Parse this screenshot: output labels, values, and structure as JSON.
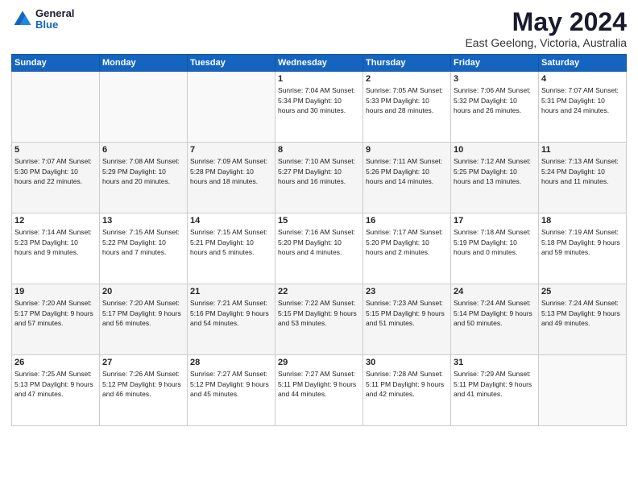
{
  "header": {
    "logo_general": "General",
    "logo_blue": "Blue",
    "month": "May 2024",
    "location": "East Geelong, Victoria, Australia"
  },
  "weekdays": [
    "Sunday",
    "Monday",
    "Tuesday",
    "Wednesday",
    "Thursday",
    "Friday",
    "Saturday"
  ],
  "weeks": [
    [
      {
        "day": "",
        "text": ""
      },
      {
        "day": "",
        "text": ""
      },
      {
        "day": "",
        "text": ""
      },
      {
        "day": "1",
        "text": "Sunrise: 7:04 AM\nSunset: 5:34 PM\nDaylight: 10 hours\nand 30 minutes."
      },
      {
        "day": "2",
        "text": "Sunrise: 7:05 AM\nSunset: 5:33 PM\nDaylight: 10 hours\nand 28 minutes."
      },
      {
        "day": "3",
        "text": "Sunrise: 7:06 AM\nSunset: 5:32 PM\nDaylight: 10 hours\nand 26 minutes."
      },
      {
        "day": "4",
        "text": "Sunrise: 7:07 AM\nSunset: 5:31 PM\nDaylight: 10 hours\nand 24 minutes."
      }
    ],
    [
      {
        "day": "5",
        "text": "Sunrise: 7:07 AM\nSunset: 5:30 PM\nDaylight: 10 hours\nand 22 minutes."
      },
      {
        "day": "6",
        "text": "Sunrise: 7:08 AM\nSunset: 5:29 PM\nDaylight: 10 hours\nand 20 minutes."
      },
      {
        "day": "7",
        "text": "Sunrise: 7:09 AM\nSunset: 5:28 PM\nDaylight: 10 hours\nand 18 minutes."
      },
      {
        "day": "8",
        "text": "Sunrise: 7:10 AM\nSunset: 5:27 PM\nDaylight: 10 hours\nand 16 minutes."
      },
      {
        "day": "9",
        "text": "Sunrise: 7:11 AM\nSunset: 5:26 PM\nDaylight: 10 hours\nand 14 minutes."
      },
      {
        "day": "10",
        "text": "Sunrise: 7:12 AM\nSunset: 5:25 PM\nDaylight: 10 hours\nand 13 minutes."
      },
      {
        "day": "11",
        "text": "Sunrise: 7:13 AM\nSunset: 5:24 PM\nDaylight: 10 hours\nand 11 minutes."
      }
    ],
    [
      {
        "day": "12",
        "text": "Sunrise: 7:14 AM\nSunset: 5:23 PM\nDaylight: 10 hours\nand 9 minutes."
      },
      {
        "day": "13",
        "text": "Sunrise: 7:15 AM\nSunset: 5:22 PM\nDaylight: 10 hours\nand 7 minutes."
      },
      {
        "day": "14",
        "text": "Sunrise: 7:15 AM\nSunset: 5:21 PM\nDaylight: 10 hours\nand 5 minutes."
      },
      {
        "day": "15",
        "text": "Sunrise: 7:16 AM\nSunset: 5:20 PM\nDaylight: 10 hours\nand 4 minutes."
      },
      {
        "day": "16",
        "text": "Sunrise: 7:17 AM\nSunset: 5:20 PM\nDaylight: 10 hours\nand 2 minutes."
      },
      {
        "day": "17",
        "text": "Sunrise: 7:18 AM\nSunset: 5:19 PM\nDaylight: 10 hours\nand 0 minutes."
      },
      {
        "day": "18",
        "text": "Sunrise: 7:19 AM\nSunset: 5:18 PM\nDaylight: 9 hours\nand 59 minutes."
      }
    ],
    [
      {
        "day": "19",
        "text": "Sunrise: 7:20 AM\nSunset: 5:17 PM\nDaylight: 9 hours\nand 57 minutes."
      },
      {
        "day": "20",
        "text": "Sunrise: 7:20 AM\nSunset: 5:17 PM\nDaylight: 9 hours\nand 56 minutes."
      },
      {
        "day": "21",
        "text": "Sunrise: 7:21 AM\nSunset: 5:16 PM\nDaylight: 9 hours\nand 54 minutes."
      },
      {
        "day": "22",
        "text": "Sunrise: 7:22 AM\nSunset: 5:15 PM\nDaylight: 9 hours\nand 53 minutes."
      },
      {
        "day": "23",
        "text": "Sunrise: 7:23 AM\nSunset: 5:15 PM\nDaylight: 9 hours\nand 51 minutes."
      },
      {
        "day": "24",
        "text": "Sunrise: 7:24 AM\nSunset: 5:14 PM\nDaylight: 9 hours\nand 50 minutes."
      },
      {
        "day": "25",
        "text": "Sunrise: 7:24 AM\nSunset: 5:13 PM\nDaylight: 9 hours\nand 49 minutes."
      }
    ],
    [
      {
        "day": "26",
        "text": "Sunrise: 7:25 AM\nSunset: 5:13 PM\nDaylight: 9 hours\nand 47 minutes."
      },
      {
        "day": "27",
        "text": "Sunrise: 7:26 AM\nSunset: 5:12 PM\nDaylight: 9 hours\nand 46 minutes."
      },
      {
        "day": "28",
        "text": "Sunrise: 7:27 AM\nSunset: 5:12 PM\nDaylight: 9 hours\nand 45 minutes."
      },
      {
        "day": "29",
        "text": "Sunrise: 7:27 AM\nSunset: 5:11 PM\nDaylight: 9 hours\nand 44 minutes."
      },
      {
        "day": "30",
        "text": "Sunrise: 7:28 AM\nSunset: 5:11 PM\nDaylight: 9 hours\nand 42 minutes."
      },
      {
        "day": "31",
        "text": "Sunrise: 7:29 AM\nSunset: 5:11 PM\nDaylight: 9 hours\nand 41 minutes."
      },
      {
        "day": "",
        "text": ""
      }
    ]
  ]
}
